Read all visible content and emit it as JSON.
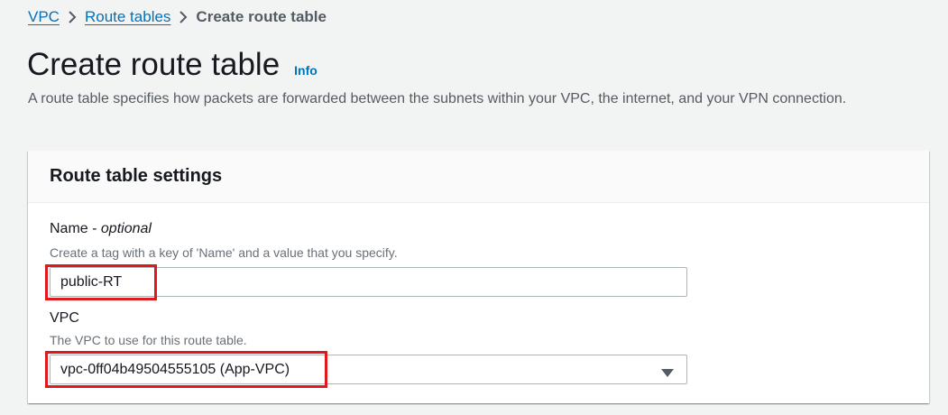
{
  "breadcrumb": {
    "items": [
      {
        "label": "VPC"
      },
      {
        "label": "Route tables"
      },
      {
        "label": "Create route table"
      }
    ]
  },
  "header": {
    "title": "Create route table",
    "info_label": "Info",
    "description": "A route table specifies how packets are forwarded between the subnets within your VPC, the internet, and your VPN connection."
  },
  "panel": {
    "title": "Route table settings",
    "name_field": {
      "label": "Name",
      "optional": "optional",
      "description": "Create a tag with a key of 'Name' and a value that you specify.",
      "value": "public-RT"
    },
    "vpc_field": {
      "label": "VPC",
      "description": "The VPC to use for this route table.",
      "selected": "vpc-0ff04b49504555105 (App-VPC)"
    }
  },
  "colors": {
    "link": "#0073bb",
    "highlight": "#e0191e",
    "background": "#f2f3f3"
  }
}
